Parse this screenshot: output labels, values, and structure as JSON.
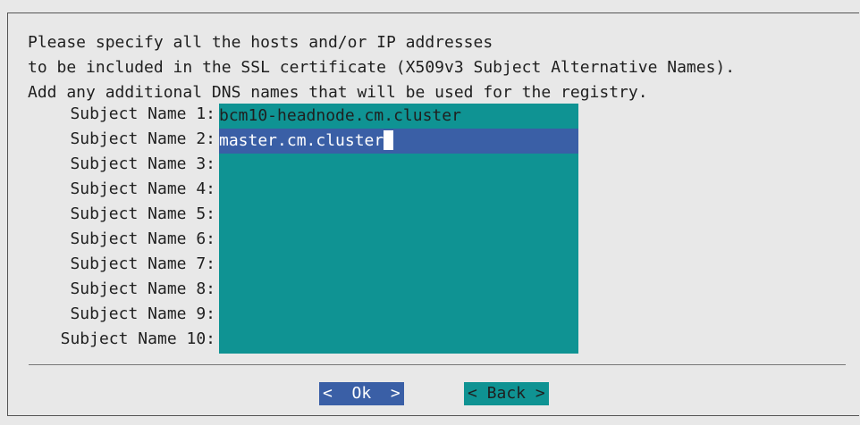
{
  "prompt": {
    "line1": "Please specify all the hosts and/or IP addresses",
    "line2": "to be included in the SSL certificate (X509v3 Subject Alternative Names).",
    "line3": "Add any additional DNS names that will be used for the registry."
  },
  "subjects": [
    {
      "label": " Subject Name 1:",
      "value": "bcm10-headnode.cm.cluster"
    },
    {
      "label": " Subject Name 2:",
      "value": "master.cm.cluster"
    },
    {
      "label": " Subject Name 3:",
      "value": ""
    },
    {
      "label": " Subject Name 4:",
      "value": ""
    },
    {
      "label": " Subject Name 5:",
      "value": ""
    },
    {
      "label": " Subject Name 6:",
      "value": ""
    },
    {
      "label": " Subject Name 7:",
      "value": ""
    },
    {
      "label": " Subject Name 8:",
      "value": ""
    },
    {
      "label": " Subject Name 9:",
      "value": ""
    },
    {
      "label": "Subject Name 10:",
      "value": ""
    }
  ],
  "buttons": {
    "ok": "<  Ok  >",
    "back": "< Back >"
  },
  "colors": {
    "field_bg": "#0f9393",
    "active_bg": "#3a5fa6"
  }
}
